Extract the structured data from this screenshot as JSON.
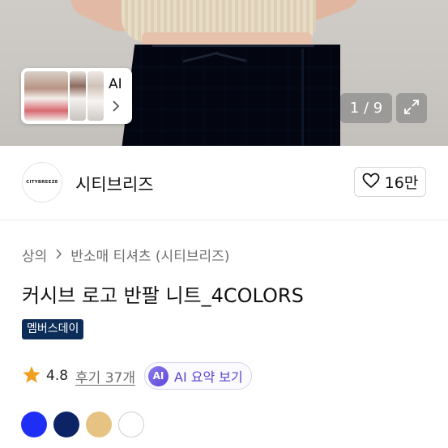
{
  "gallery": {
    "thumbnail_label": "AI",
    "counter": "1 / 9",
    "thumbnail_icons": [
      "chevron-right-icon",
      "expand-icon"
    ]
  },
  "brand": {
    "logo_text": "CITYBREEZE",
    "name": "시티브리즈",
    "like_count": "16만"
  },
  "breadcrumb": [
    "상의",
    "반소매 티셔츠 (시티브리즈)"
  ],
  "product": {
    "title": "커시브 로고 반팔 니트_4COLORS",
    "badge": "멤버스데이"
  },
  "rating": {
    "value": "4.8",
    "reviews": "후기 37개",
    "ai_badge": "AI",
    "ai_summary": "AI 요약 보기",
    "star_color": "#f0a020"
  },
  "colors": [
    {
      "name": "blue",
      "hex": "#1f2ef5"
    },
    {
      "name": "navy",
      "hex": "#0c2466"
    },
    {
      "name": "beige",
      "hex": "#e6c383"
    },
    {
      "name": "white",
      "hex": "#ffffff"
    }
  ]
}
